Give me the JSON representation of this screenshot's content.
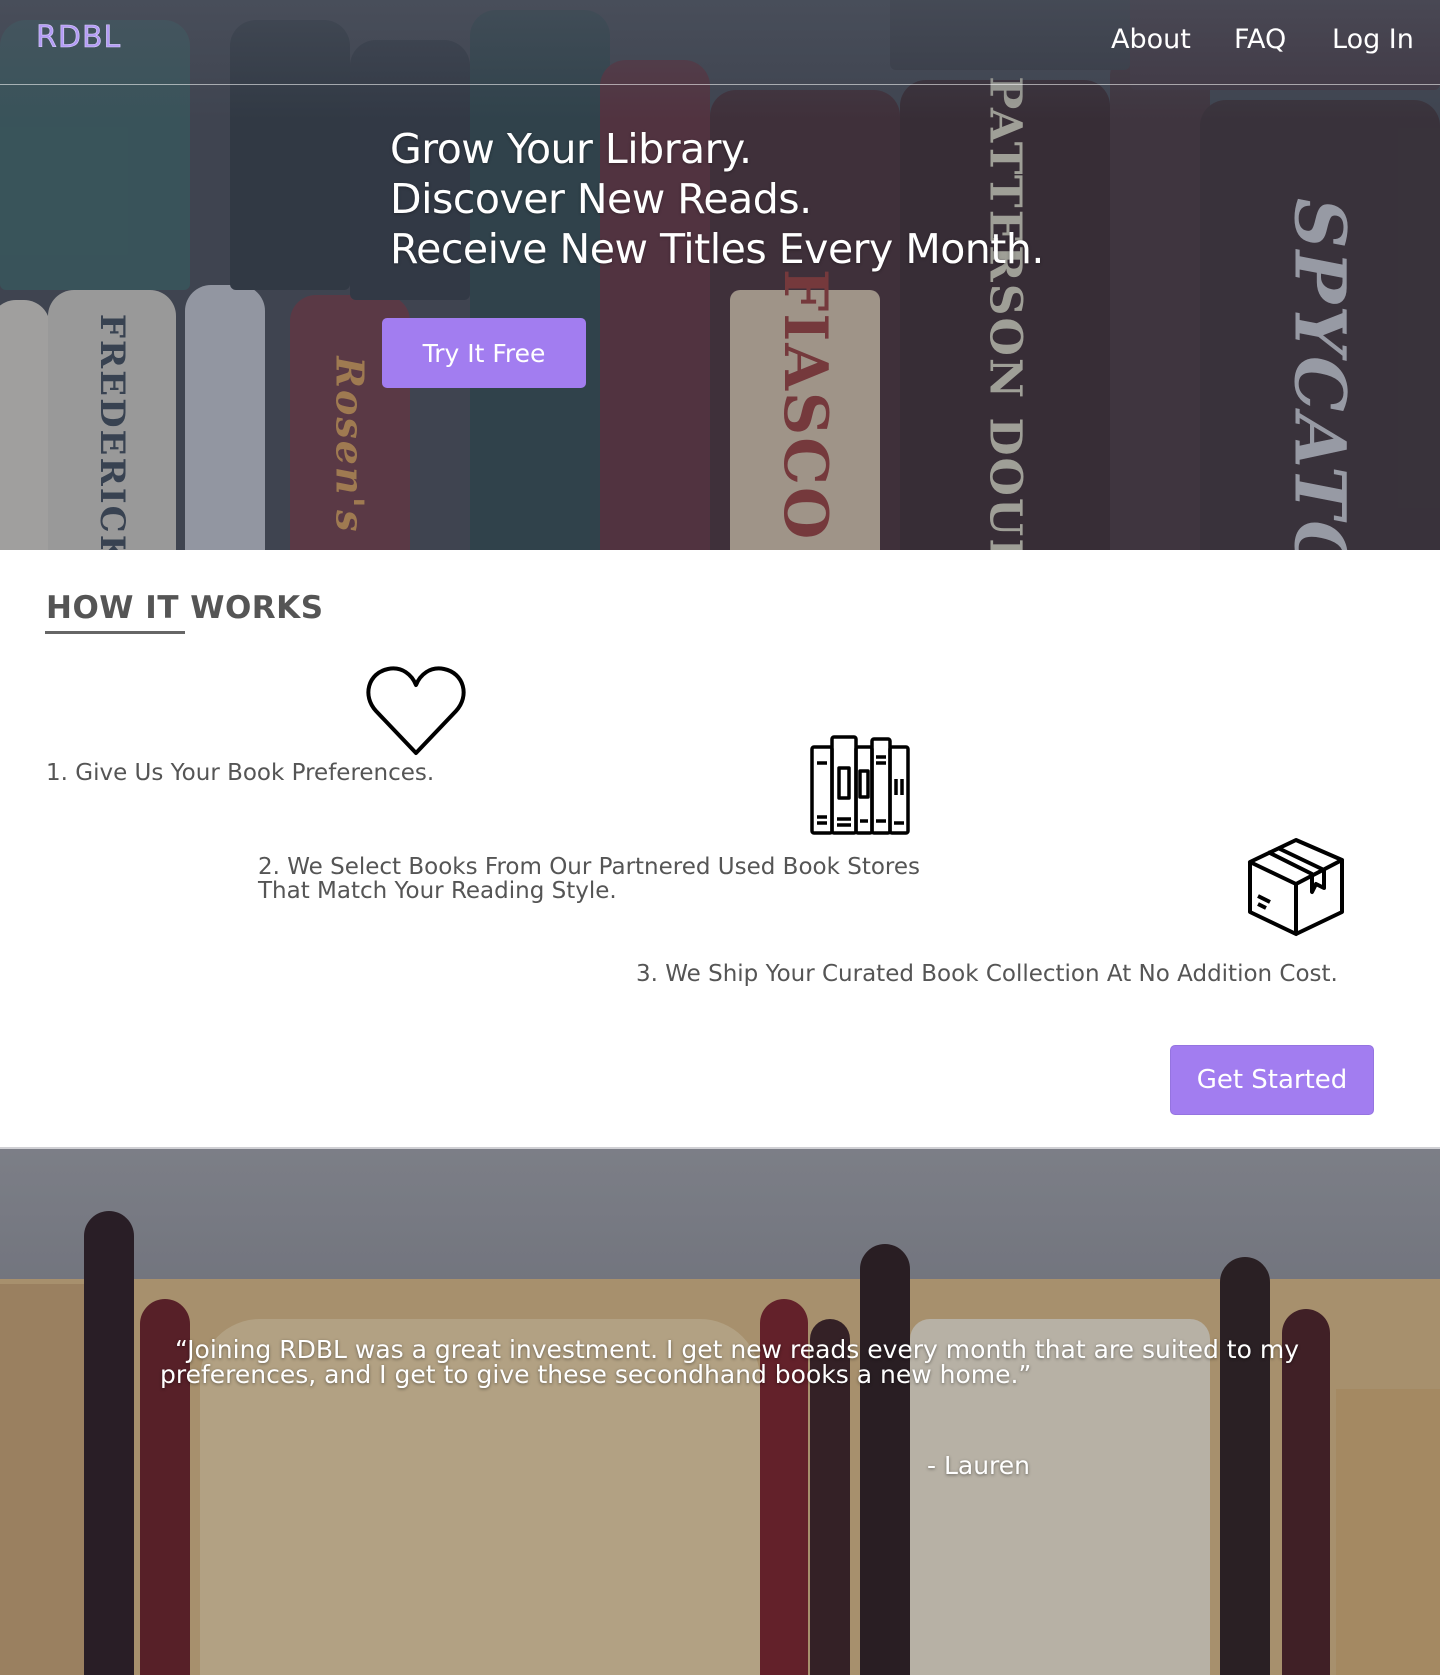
{
  "nav": {
    "logo": "RDBL",
    "links": [
      "About",
      "FAQ",
      "Log In"
    ]
  },
  "hero": {
    "lines": [
      "Grow Your Library.",
      "Discover New Reads.",
      "Receive New Titles Every Month."
    ],
    "cta": "Try It Free",
    "book_spines": [
      "FREDERICK",
      "Rosen's",
      "FIASCO",
      "PATTERSON DOUBLE",
      "SPYCATC"
    ]
  },
  "how_it_works": {
    "title": "HOW IT WORKS",
    "steps": [
      {
        "text": "1. Give Us Your Book Preferences.",
        "icon": "heart-icon"
      },
      {
        "line1": "2. We Select Books From Our Partnered Used Book Stores",
        "line2": "That Match Your Reading Style.",
        "icon": "books-icon"
      },
      {
        "text": "3. We Ship Your Curated Book Collection At No Addition Cost.",
        "icon": "box-icon"
      }
    ],
    "cta": "Get Started"
  },
  "testimonial": {
    "line1": "“Joining RDBL was a great investment. I get new reads every month that are suited to my",
    "line2": "preferences, and I get to give these secondhand books a new home.”",
    "author": "- Lauren"
  },
  "colors": {
    "accent": "#a27df0",
    "logo": "#b39cf5",
    "text": "#555555"
  }
}
